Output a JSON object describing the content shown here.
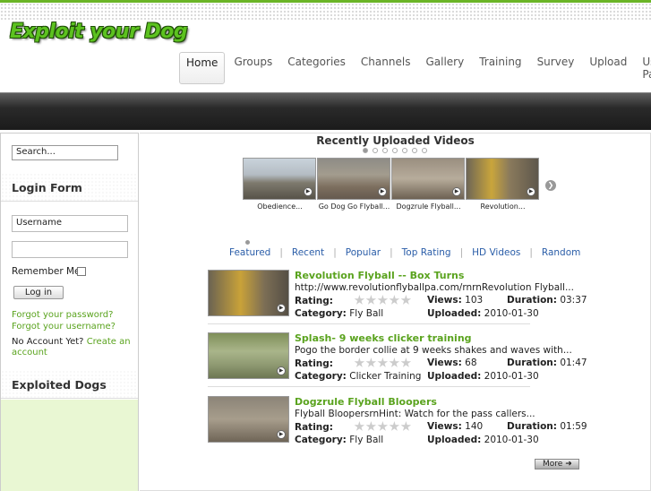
{
  "site": {
    "logo": "Exploit your Dog"
  },
  "nav": [
    {
      "label": "Home",
      "active": true
    },
    {
      "label": "Groups"
    },
    {
      "label": "Categories"
    },
    {
      "label": "Channels"
    },
    {
      "label": "Gallery"
    },
    {
      "label": "Training"
    },
    {
      "label": "Survey"
    },
    {
      "label": "Upload"
    },
    {
      "label": "User Panel"
    }
  ],
  "sidebar": {
    "search_placeholder": "Search...",
    "login_heading": "Login Form",
    "username_placeholder": "Username",
    "password_placeholder": "",
    "remember_label": "Remember Me",
    "login_button": "Log in",
    "forgot_password": "Forgot your password?",
    "forgot_username": "Forgot your username?",
    "no_account": "No Account Yet?",
    "create_account": "Create an account",
    "exploited_heading": "Exploited Dogs"
  },
  "recent": {
    "title": "Recently Uploaded Videos",
    "thumbs": [
      {
        "caption": "Obedience..."
      },
      {
        "caption": "Go Dog Go Flyball..."
      },
      {
        "caption": "Dogzrule Flyball..."
      },
      {
        "caption": "Revolution..."
      }
    ]
  },
  "tabs": [
    "Featured",
    "Recent",
    "Popular",
    "Top Rating",
    "HD Videos",
    "Random"
  ],
  "labels": {
    "rating": "Rating:",
    "views": "Views:",
    "duration": "Duration:",
    "category": "Category:",
    "uploaded": "Uploaded:"
  },
  "videos": [
    {
      "title": "Revolution Flyball -- Box Turns",
      "desc": "http://www.revolutionflyballpa.com/rnrnRevolution Flyball...",
      "rating": 0,
      "views": "103",
      "duration": "03:37",
      "category": "Fly Ball",
      "uploaded": "2010-01-30"
    },
    {
      "title": "Splash- 9 weeks clicker training",
      "desc": "Pogo the border collie at 9 weeks shakes and waves with...",
      "rating": 0,
      "views": "68",
      "duration": "01:47",
      "category": "Clicker Training",
      "uploaded": "2010-01-30"
    },
    {
      "title": "Dogzrule Flyball Bloopers",
      "desc": "Flyball BloopersrnHint: Watch for the pass callers...",
      "rating": 0,
      "views": "140",
      "duration": "01:59",
      "category": "Fly Ball",
      "uploaded": "2010-01-30"
    }
  ],
  "more_button": "More"
}
